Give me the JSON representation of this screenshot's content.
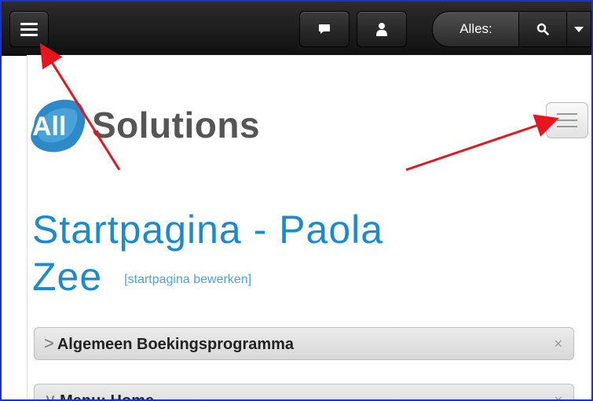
{
  "toolbar": {
    "scope_label": "Alles:",
    "icons": {
      "menu": "hamburger-icon",
      "messages": "comment-icon",
      "user": "user-icon",
      "search": "search-icon",
      "dropdown": "caret-down-icon"
    }
  },
  "logo": {
    "mark_text": "All",
    "word_text": "Solutions"
  },
  "page": {
    "title_line1": "Startpagina - Paola",
    "title_line2": "Zee",
    "edit_link": "[startpagina bewerken]"
  },
  "panels": [
    {
      "label": "Algemeen Boekingsprogramma",
      "chevron": ">",
      "close": "×"
    },
    {
      "label": "Menu: Home",
      "chevron": "∨",
      "close": "×"
    }
  ],
  "colors": {
    "title": "#1b8bd0",
    "annotation_arrow": "#e8141e",
    "frame": "#1a33cc"
  }
}
